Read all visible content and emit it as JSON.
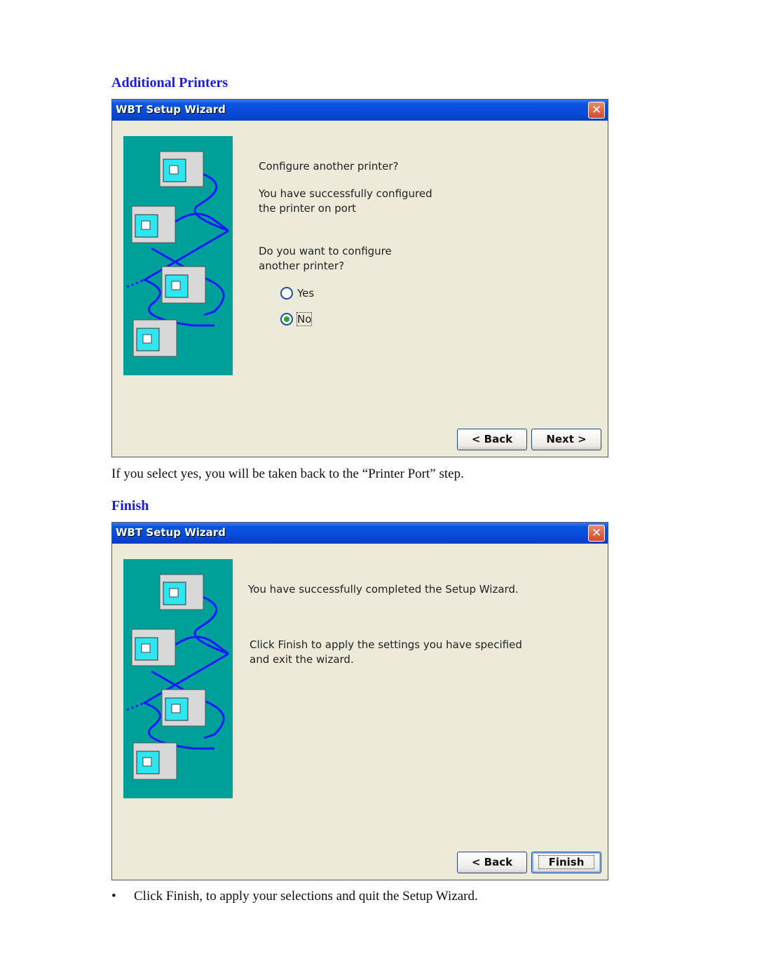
{
  "section1": {
    "heading": "Additional Printers",
    "window": {
      "title": "WBT Setup Wizard",
      "close_label": "✕",
      "prompt_title": "Configure another printer?",
      "success_line1": "You have successfully configured",
      "success_line2": "the printer on port",
      "question_line1": "Do you want to configure",
      "question_line2": "another printer?",
      "options": [
        {
          "label": "Yes",
          "selected": false
        },
        {
          "label": "No",
          "selected": true
        }
      ],
      "back_button": "< Back",
      "next_button": "Next >"
    },
    "caption": "If you select yes, you will be taken back to the “Printer Port” step."
  },
  "section2": {
    "heading": "Finish",
    "window": {
      "title": "WBT Setup Wizard",
      "close_label": "✕",
      "completed_text": "You have successfully completed the Setup Wizard.",
      "instruction_line1": "Click Finish to apply the settings you have specified",
      "instruction_line2": "and exit the wizard.",
      "back_button": "< Back",
      "finish_button": "Finish"
    },
    "bullet": "Click Finish, to apply your selections and quit the Setup Wizard."
  },
  "colors": {
    "heading": "#1a1ae6",
    "titlebar": "#0848d6",
    "art_background": "#00a09a",
    "window_body": "#ecead9"
  }
}
